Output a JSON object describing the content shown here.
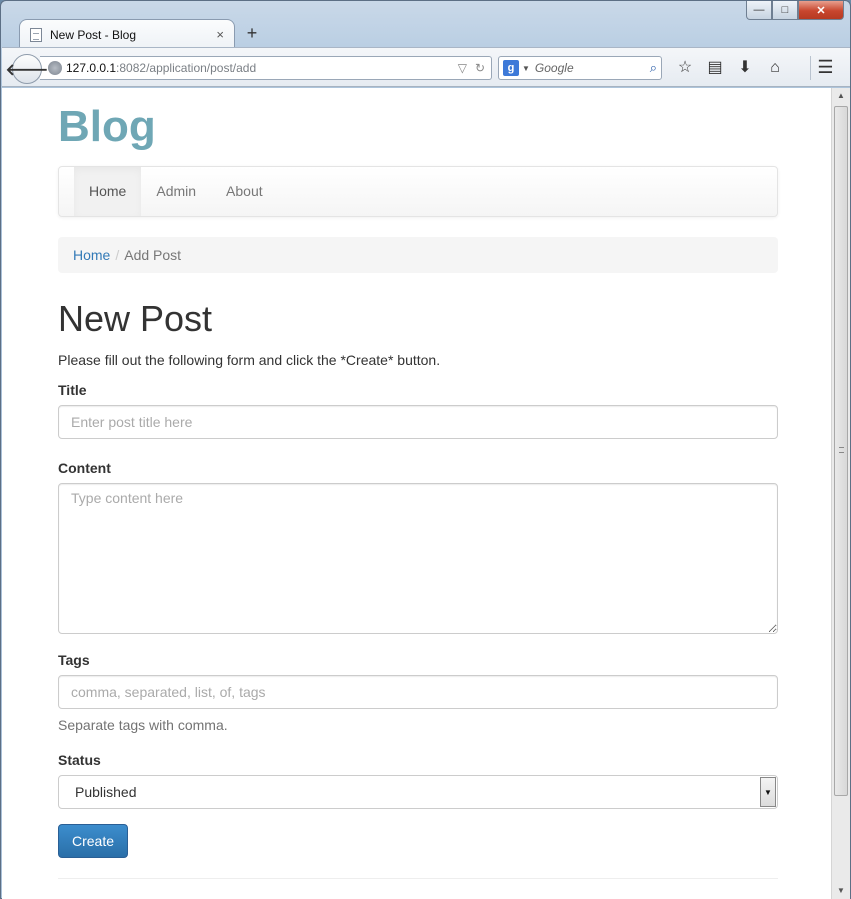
{
  "browser": {
    "tab_title": "New Post - Blog",
    "tab_close": "×",
    "new_tab": "+",
    "url_host": "127.0.0.1",
    "url_rest": ":8082/application/post/add",
    "search_placeholder": "Google",
    "search_engine_logo": "g",
    "win_min": "—",
    "win_max": "□",
    "win_close": "✕"
  },
  "site": {
    "brand": "Blog",
    "nav": [
      {
        "label": "Home",
        "active": true
      },
      {
        "label": "Admin",
        "active": false
      },
      {
        "label": "About",
        "active": false
      }
    ]
  },
  "breadcrumb": {
    "home": "Home",
    "separator": "/",
    "current": "Add Post"
  },
  "form": {
    "title": "New Post",
    "intro": "Please fill out the following form and click the *Create* button.",
    "title_label": "Title",
    "title_placeholder": "Enter post title here",
    "content_label": "Content",
    "content_placeholder": "Type content here",
    "tags_label": "Tags",
    "tags_placeholder": "comma, separated, list, of, tags",
    "tags_help": "Separate tags with comma.",
    "status_label": "Status",
    "status_value": "Published",
    "submit_label": "Create"
  },
  "icons": {
    "back": "arrow-left-icon",
    "bookmark": "star-icon",
    "reading_list": "reading-list-icon",
    "download": "download-icon",
    "home": "home-icon",
    "menu": "hamburger-icon"
  },
  "colors": {
    "brand": "#6fa7b5",
    "link": "#337ab7",
    "button": "#337ab7"
  }
}
